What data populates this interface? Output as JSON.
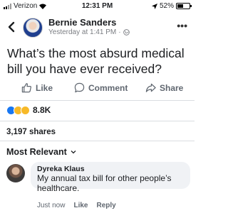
{
  "status_bar": {
    "carrier": "Verizon",
    "time": "12:31 PM",
    "battery": "52%",
    "battery_level": 0.52
  },
  "post": {
    "author": "Bernie Sanders",
    "timestamp": "Yesterday at 1:41 PM",
    "separator": "·",
    "text": "What’s the most absurd medical bill you have ever received?",
    "back_icon": "chevron-left-icon",
    "more_icon": "more-horizontal-icon",
    "privacy_icon": "globe-icon"
  },
  "actions": {
    "like": "Like",
    "comment": "Comment",
    "share": "Share"
  },
  "reactions": {
    "icons": [
      "like-reaction-icon",
      "sad-reaction-icon",
      "wow-reaction-icon"
    ],
    "count": "8.8K"
  },
  "shares": "3,197 shares",
  "sort": {
    "label": "Most Relevant"
  },
  "comment": {
    "author": "Dyreka Klaus",
    "text": "My annual tax bill for other people’s healthcare.",
    "time": "Just now",
    "like": "Like",
    "reply": "Reply"
  },
  "colors": {
    "text": "#1c1e21",
    "secondary": "#606770",
    "bubble": "#f0f2f5",
    "like_blue": "#1877f2",
    "reaction_yellow": "#f7b928"
  }
}
